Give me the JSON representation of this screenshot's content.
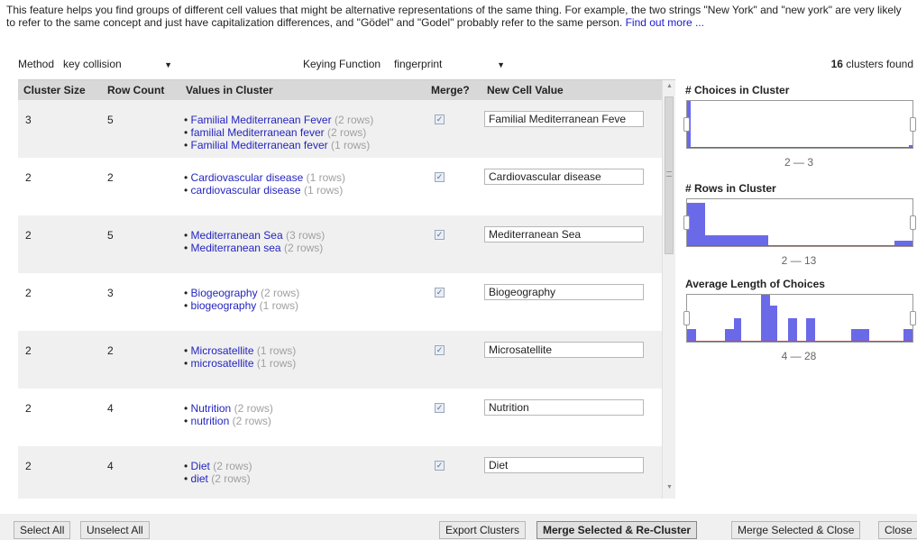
{
  "intro": {
    "text": "This feature helps you find groups of different cell values that might be alternative representations of the same thing. For example, the two strings \"New York\" and \"new york\" are very likely to refer to the same concept and just have capitalization differences, and \"Gödel\" and \"Godel\" probably refer to the same person.",
    "link": "Find out more ..."
  },
  "controls": {
    "method_label": "Method",
    "method_value": "key collision",
    "keying_label": "Keying Function",
    "keying_value": "fingerprint",
    "clusters_count": "16",
    "clusters_suffix": "clusters found"
  },
  "table": {
    "headers": [
      "Cluster Size",
      "Row Count",
      "Values in Cluster",
      "Merge?",
      "New Cell Value"
    ],
    "rows": [
      {
        "size": "3",
        "count": "5",
        "values": [
          {
            "text": "Familial Mediterranean Fever",
            "rows": "(2 rows)"
          },
          {
            "text": "familial Mediterranean fever",
            "rows": "(2 rows)"
          },
          {
            "text": "Familial Mediterranean fever",
            "rows": "(1 rows)"
          }
        ],
        "new_value": "Familial Mediterranean Feve"
      },
      {
        "size": "2",
        "count": "2",
        "values": [
          {
            "text": "Cardiovascular disease",
            "rows": "(1 rows)"
          },
          {
            "text": "cardiovascular disease",
            "rows": "(1 rows)"
          }
        ],
        "new_value": "Cardiovascular disease"
      },
      {
        "size": "2",
        "count": "5",
        "values": [
          {
            "text": "Mediterranean Sea",
            "rows": "(3 rows)"
          },
          {
            "text": "Mediterranean sea",
            "rows": "(2 rows)"
          }
        ],
        "new_value": "Mediterranean Sea"
      },
      {
        "size": "2",
        "count": "3",
        "values": [
          {
            "text": "Biogeography",
            "rows": "(2 rows)"
          },
          {
            "text": "biogeography",
            "rows": "(1 rows)"
          }
        ],
        "new_value": "Biogeography"
      },
      {
        "size": "2",
        "count": "2",
        "values": [
          {
            "text": "Microsatellite",
            "rows": "(1 rows)"
          },
          {
            "text": "microsatellite",
            "rows": "(1 rows)"
          }
        ],
        "new_value": "Microsatellite"
      },
      {
        "size": "2",
        "count": "4",
        "values": [
          {
            "text": "Nutrition",
            "rows": "(2 rows)"
          },
          {
            "text": "nutrition",
            "rows": "(2 rows)"
          }
        ],
        "new_value": "Nutrition"
      },
      {
        "size": "2",
        "count": "4",
        "values": [
          {
            "text": "Diet",
            "rows": "(2 rows)"
          },
          {
            "text": "diet",
            "rows": "(2 rows)"
          }
        ],
        "new_value": "Diet"
      }
    ]
  },
  "facets": [
    {
      "title": "# Choices in Cluster",
      "range": "2 — 3"
    },
    {
      "title": "# Rows in Cluster",
      "range": "2 — 13"
    },
    {
      "title": "Average Length of Choices",
      "range": "4 — 28"
    }
  ],
  "footer": {
    "select_all": "Select All",
    "unselect_all": "Unselect All",
    "export": "Export Clusters",
    "merge_recluster": "Merge Selected & Re-Cluster",
    "merge_close": "Merge Selected & Close",
    "close": "Close"
  },
  "colors": {
    "link": "#2424c0",
    "bar": "#6a6ae8",
    "header_bg": "#d8d8d8",
    "shade_row": "#f0f0f0"
  }
}
